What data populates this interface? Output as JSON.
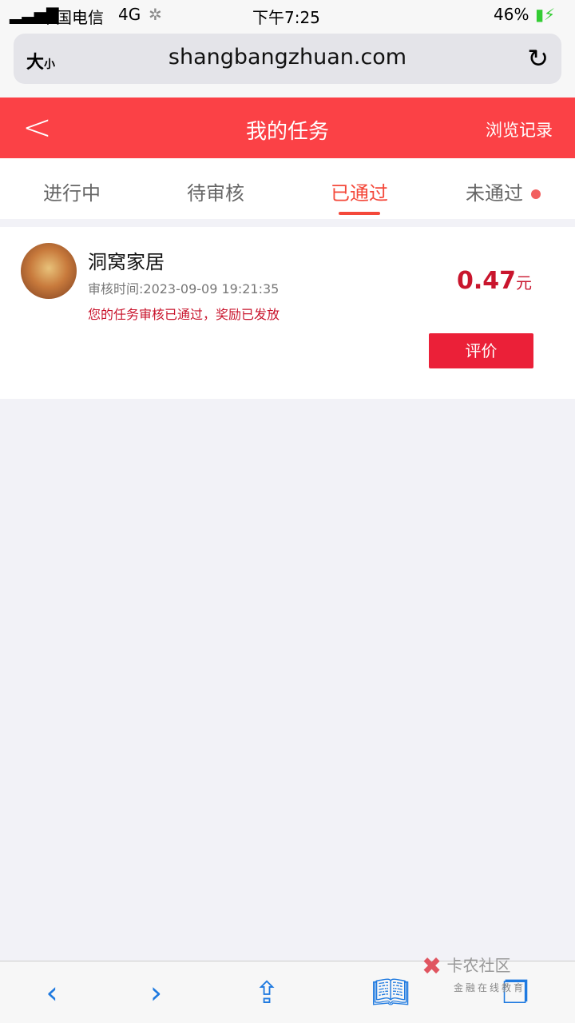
{
  "status": {
    "carrier": "中国电信",
    "network": "4G",
    "time": "下午7:25",
    "battery": "46%"
  },
  "browser": {
    "text_size": "大",
    "text_size_small": "小",
    "url": "shangbangzhuan.com"
  },
  "header": {
    "title": "我的任务",
    "history": "浏览记录"
  },
  "tabs": [
    {
      "label": "进行中"
    },
    {
      "label": "待审核"
    },
    {
      "label": "已通过",
      "active": true
    },
    {
      "label": "未通过",
      "badge_dot": true
    }
  ],
  "task": {
    "name": "洞窝家居",
    "review_time": "审核时间:2023-09-09 19:21:35",
    "message": "您的任务审核已通过，奖励已发放",
    "amount": "0.47",
    "unit": "元",
    "button": "评价"
  },
  "watermark": {
    "title": "卡农社区",
    "subtitle": "金融在线教育"
  },
  "colors": {
    "accent": "#fb4146",
    "price": "#c9152d",
    "button": "#eb2038",
    "ios_blue": "#1f7ae0"
  }
}
